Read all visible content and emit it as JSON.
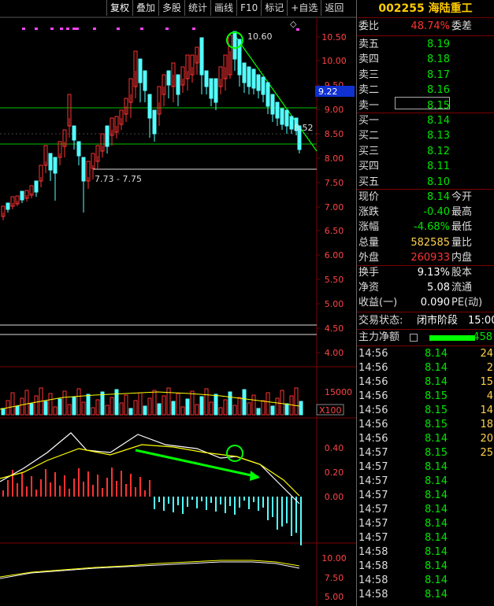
{
  "toolbar": [
    {
      "label": "复权",
      "active": true
    },
    {
      "label": "叠加"
    },
    {
      "label": "多股"
    },
    {
      "label": "统计"
    },
    {
      "label": "画线"
    },
    {
      "label": "F10"
    },
    {
      "label": "标记"
    },
    {
      "label": "+自选"
    },
    {
      "label": "返回"
    }
  ],
  "stock": {
    "code": "002255",
    "name": "海陆重工"
  },
  "order_ratio": {
    "label": "委比",
    "value": "48.74%",
    "right_label": "委差"
  },
  "asks": [
    {
      "label": "卖五",
      "price": "8.19"
    },
    {
      "label": "卖四",
      "price": "8.18"
    },
    {
      "label": "卖三",
      "price": "8.17"
    },
    {
      "label": "卖二",
      "price": "8.16"
    },
    {
      "label": "卖一",
      "price": "8.15"
    }
  ],
  "bids": [
    {
      "label": "买一",
      "price": "8.14"
    },
    {
      "label": "买二",
      "price": "8.13"
    },
    {
      "label": "买三",
      "price": "8.12"
    },
    {
      "label": "买四",
      "price": "8.11"
    },
    {
      "label": "买五",
      "price": "8.10"
    }
  ],
  "quote": [
    {
      "label": "现价",
      "value": "8.14",
      "color": "g",
      "right_label": "今开"
    },
    {
      "label": "涨跌",
      "value": "-0.40",
      "color": "g",
      "right_label": "最高"
    },
    {
      "label": "涨幅",
      "value": "-4.68%",
      "color": "g",
      "right_label": "最低"
    },
    {
      "label": "总量",
      "value": "582585",
      "color": "y",
      "right_label": "量比"
    },
    {
      "label": "外盘",
      "value": "260933",
      "color": "r",
      "right_label": "内盘"
    }
  ],
  "fund": [
    {
      "label": "换手",
      "value": "9.13%",
      "right_label": "股本"
    },
    {
      "label": "净资",
      "value": "5.08",
      "right_label": "流通"
    },
    {
      "label": "收益(一)",
      "value": "0.090",
      "right_label": "PE(动)"
    }
  ],
  "trade_status": {
    "label": "交易状态:",
    "value": "闭市阶段",
    "time": "15:00"
  },
  "main_force": {
    "label": "主力净额",
    "value": "-458"
  },
  "ticks": [
    {
      "time": "14:56",
      "price": "8.14",
      "vol": "24"
    },
    {
      "time": "14:56",
      "price": "8.14",
      "vol": "2"
    },
    {
      "time": "14:56",
      "price": "8.14",
      "vol": "15"
    },
    {
      "time": "14:56",
      "price": "8.15",
      "vol": "4"
    },
    {
      "time": "14:56",
      "price": "8.15",
      "vol": "14"
    },
    {
      "time": "14:56",
      "price": "8.15",
      "vol": "18"
    },
    {
      "time": "14:56",
      "price": "8.14",
      "vol": "20"
    },
    {
      "time": "14:57",
      "price": "8.15",
      "vol": "25"
    },
    {
      "time": "14:57",
      "price": "8.14",
      "vol": ""
    },
    {
      "time": "14:57",
      "price": "8.14",
      "vol": ""
    },
    {
      "time": "14:57",
      "price": "8.14",
      "vol": ""
    },
    {
      "time": "14:57",
      "price": "8.14",
      "vol": ""
    },
    {
      "time": "14:57",
      "price": "8.14",
      "vol": ""
    },
    {
      "time": "14:57",
      "price": "8.14",
      "vol": ""
    },
    {
      "time": "14:58",
      "price": "8.14",
      "vol": ""
    },
    {
      "time": "14:58",
      "price": "8.14",
      "vol": ""
    },
    {
      "time": "14:58",
      "price": "8.14",
      "vol": ""
    },
    {
      "time": "14:58",
      "price": "8.14",
      "vol": ""
    }
  ],
  "chart": {
    "price_axis": [
      "10.50",
      "10.00",
      "9.50",
      "9.00",
      "8.50",
      "8.00",
      "7.50",
      "7.00",
      "6.50",
      "6.00",
      "5.50",
      "5.00",
      "4.50",
      "4.00"
    ],
    "current_price_tag": "9.22",
    "peak_label": "10.60",
    "right_label": "8.52",
    "range_label": "7.73 - 7.75",
    "volume_axis": "15000",
    "volume_unit": "X100",
    "macd_axis": [
      "0.40",
      "0.20",
      "0.00"
    ],
    "lower_axis": [
      "10.00",
      "7.50",
      "5.00"
    ],
    "colors": {
      "up": "#ff3232",
      "down": "#54ffff",
      "ma": "#ffff00",
      "support": "#00c000",
      "trend": "#00ff00",
      "marker": "#ff44ff"
    }
  }
}
